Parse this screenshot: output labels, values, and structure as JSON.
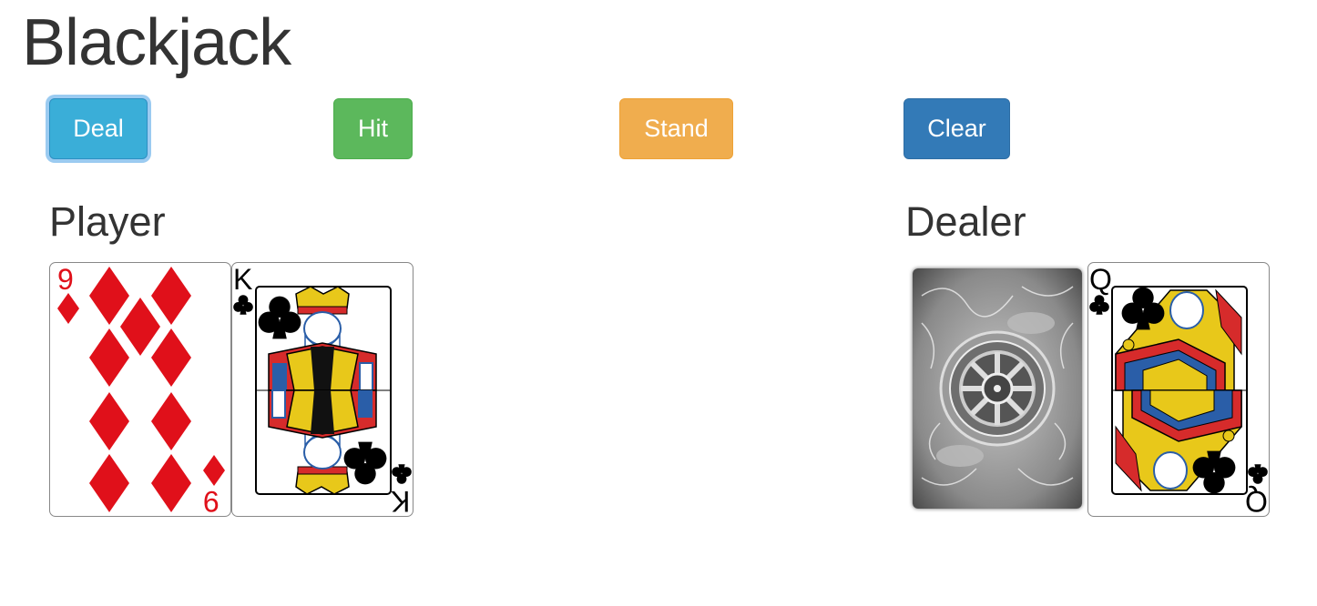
{
  "title": "Blackjack",
  "buttons": {
    "deal": "Deal",
    "hit": "Hit",
    "stand": "Stand",
    "clear": "Clear"
  },
  "player": {
    "label": "Player",
    "cards": [
      {
        "rank": "9",
        "suit": "diamonds",
        "color": "#e0101a"
      },
      {
        "rank": "K",
        "suit": "clubs",
        "color": "#000000"
      }
    ]
  },
  "dealer": {
    "label": "Dealer",
    "cards": [
      {
        "face_down": true
      },
      {
        "rank": "Q",
        "suit": "clubs",
        "color": "#000000"
      }
    ]
  },
  "colors": {
    "deal": "#3aaed8",
    "hit": "#5cb85c",
    "stand": "#f0ad4e",
    "clear": "#337ab7"
  }
}
